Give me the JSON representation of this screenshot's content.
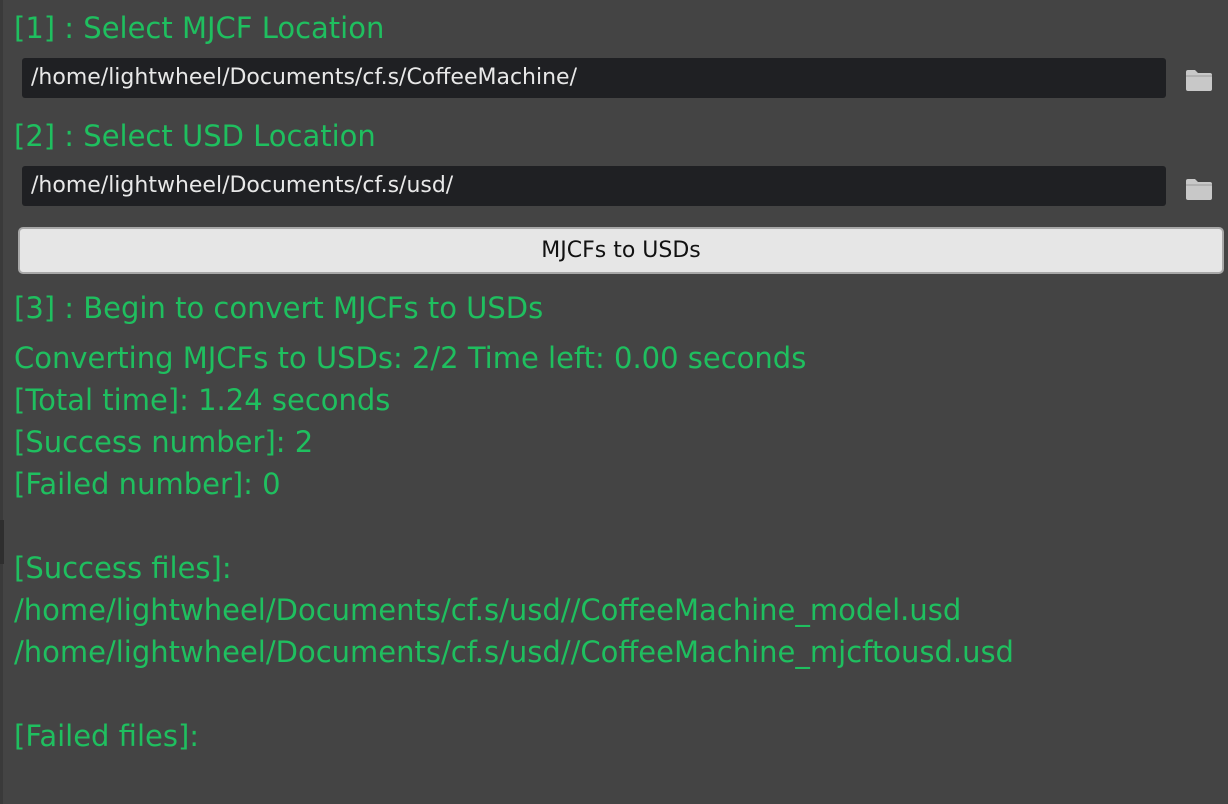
{
  "colors": {
    "background": "#444444",
    "accent_text": "#1fbf5f",
    "field_background": "#1f2023",
    "field_text": "#e8e8e8",
    "button_background": "#e6e6e6",
    "button_text": "#111111",
    "folder_icon": "#c8c8c8"
  },
  "step1": {
    "title": "[1] : Select MJCF Location",
    "path_value": "/home/lightwheel/Documents/cf.s/CoffeeMachine/",
    "browse_icon": "folder-icon"
  },
  "step2": {
    "title": "[2] : Select USD Location",
    "path_value": "/home/lightwheel/Documents/cf.s/usd/",
    "browse_icon": "folder-icon"
  },
  "convert_button": {
    "label": "MJCFs to USDs"
  },
  "step3": {
    "title": "[3] : Begin to convert MJCFs to USDs"
  },
  "log": {
    "progress": "Converting MJCFs to USDs: 2/2 Time left: 0.00 seconds",
    "total_time": "[Total time]: 1.24 seconds",
    "success_number": "[Success number]: 2",
    "failed_number": "[Failed number]: 0",
    "success_files_header": "[Success files]:",
    "success_files": [
      "/home/lightwheel/Documents/cf.s/usd//CoffeeMachine_model.usd",
      "/home/lightwheel/Documents/cf.s/usd//CoffeeMachine_mjcftousd.usd"
    ],
    "failed_files_header": "[Failed files]:",
    "failed_files": []
  }
}
